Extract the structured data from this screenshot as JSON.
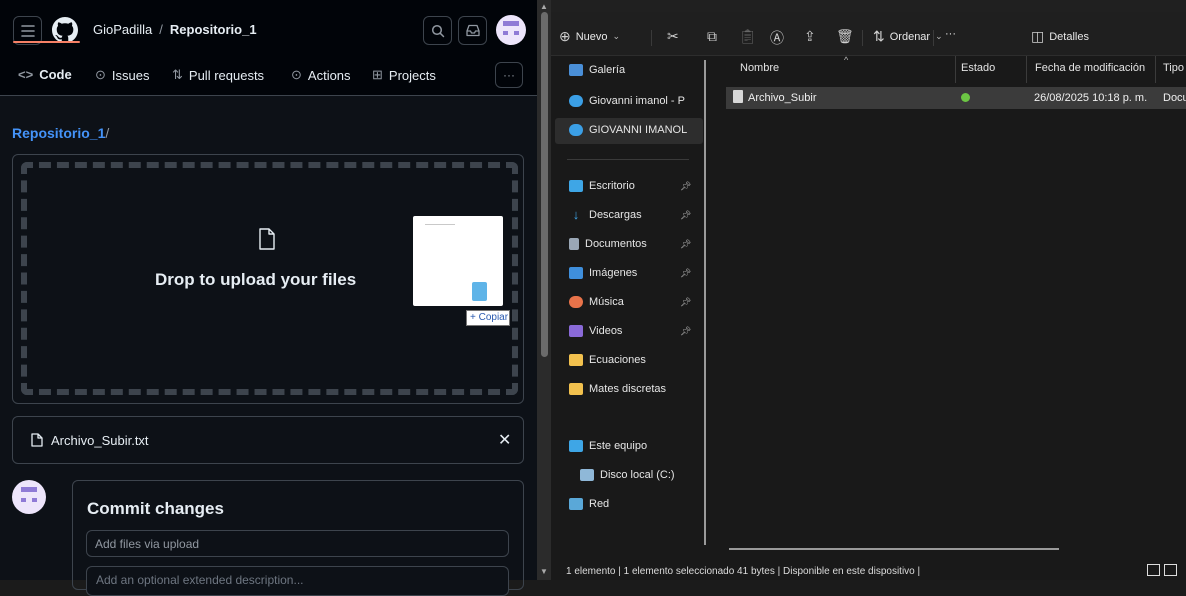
{
  "github": {
    "owner": "GioPadilla",
    "repo": "Repositorio_1",
    "tabs": [
      {
        "label": "Code",
        "icon": "code-icon"
      },
      {
        "label": "Issues",
        "icon": "issue-opened-icon"
      },
      {
        "label": "Pull requests",
        "icon": "git-pull-request-icon"
      },
      {
        "label": "Actions",
        "icon": "play-icon"
      },
      {
        "label": "Projects",
        "icon": "table-icon"
      }
    ],
    "path_label": "Repositorio_1",
    "path_sep": "/",
    "drop_text": "Drop to upload your files",
    "copy_tip": "+ Copiar",
    "file_name": "Archivo_Subir.txt",
    "commit_title": "Commit changes",
    "commit_placeholder": "Add files via upload",
    "commit_desc_placeholder": "Add an optional extended description..."
  },
  "explorer": {
    "toolbar": {
      "new_label": "Nuevo",
      "sort_label": "Ordenar",
      "more_label": "···",
      "details_label": "Detalles"
    },
    "nav": [
      {
        "label": "Galería",
        "icon": "gallery-icon"
      },
      {
        "label": "Giovanni imanol - P",
        "icon": "onedrive-icon"
      },
      {
        "label": "GIOVANNI IMANOL",
        "icon": "onedrive-icon"
      },
      {
        "label": "Escritorio",
        "icon": "desktop-icon"
      },
      {
        "label": "Descargas",
        "icon": "download-icon"
      },
      {
        "label": "Documentos",
        "icon": "documents-icon"
      },
      {
        "label": "Imágenes",
        "icon": "pictures-icon"
      },
      {
        "label": "Música",
        "icon": "music-icon"
      },
      {
        "label": "Videos",
        "icon": "videos-icon"
      },
      {
        "label": "Ecuaciones",
        "icon": "folder-icon"
      },
      {
        "label": "Mates discretas",
        "icon": "folder-icon"
      },
      {
        "label": "Este equipo",
        "icon": "this-pc-icon"
      },
      {
        "label": "Disco local (C:)",
        "icon": "drive-icon"
      },
      {
        "label": "Red",
        "icon": "network-icon"
      }
    ],
    "columns": [
      "Nombre",
      "Estado",
      "Fecha de modificación",
      "Tipo"
    ],
    "rows": [
      {
        "name": "Archivo_Subir",
        "status": "available",
        "modified": "26/08/2025 10:18 p. m.",
        "type": "Docu"
      }
    ],
    "status_bar": "1 elemento  |  1 elemento seleccionado  41 bytes  |  Disponible en este dispositivo  |"
  }
}
